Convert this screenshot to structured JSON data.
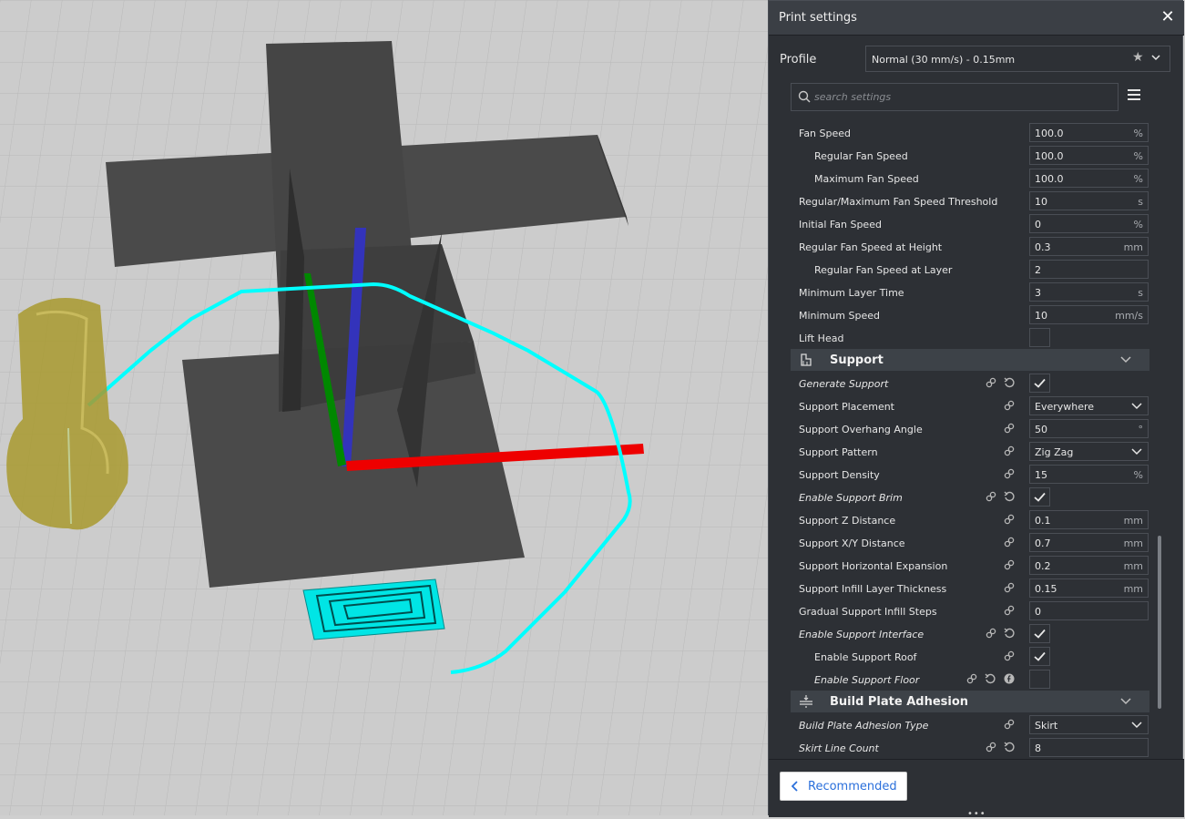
{
  "panel": {
    "title": "Print settings",
    "close": "✕",
    "profile_label": "Profile",
    "profile_value": "Normal (30 mm/s) - 0.15mm",
    "search_placeholder": "search settings"
  },
  "settings": {
    "fan_speed": {
      "label": "Fan Speed",
      "value": "100.0",
      "unit": "%"
    },
    "regular_fan_speed": {
      "label": "Regular Fan Speed",
      "value": "100.0",
      "unit": "%"
    },
    "maximum_fan_speed": {
      "label": "Maximum Fan Speed",
      "value": "100.0",
      "unit": "%"
    },
    "fan_speed_threshold": {
      "label": "Regular/Maximum Fan Speed Threshold",
      "value": "10",
      "unit": "s"
    },
    "initial_fan_speed": {
      "label": "Initial Fan Speed",
      "value": "0",
      "unit": "%"
    },
    "fan_speed_height": {
      "label": "Regular Fan Speed at Height",
      "value": "0.3",
      "unit": "mm"
    },
    "fan_speed_layer": {
      "label": "Regular Fan Speed at Layer",
      "value": "2"
    },
    "min_layer_time": {
      "label": "Minimum Layer Time",
      "value": "3",
      "unit": "s"
    },
    "min_speed": {
      "label": "Minimum Speed",
      "value": "10",
      "unit": "mm/s"
    },
    "lift_head": {
      "label": "Lift Head",
      "checked": false
    }
  },
  "support": {
    "title": "Support",
    "generate_support": {
      "label": "Generate Support",
      "checked": true
    },
    "placement": {
      "label": "Support Placement",
      "value": "Everywhere"
    },
    "overhang_angle": {
      "label": "Support Overhang Angle",
      "value": "50",
      "unit": "°"
    },
    "pattern": {
      "label": "Support Pattern",
      "value": "Zig Zag"
    },
    "density": {
      "label": "Support Density",
      "value": "15",
      "unit": "%"
    },
    "enable_brim": {
      "label": "Enable Support Brim",
      "checked": true
    },
    "z_distance": {
      "label": "Support Z Distance",
      "value": "0.1",
      "unit": "mm"
    },
    "xy_distance": {
      "label": "Support X/Y Distance",
      "value": "0.7",
      "unit": "mm"
    },
    "horizontal_expansion": {
      "label": "Support Horizontal Expansion",
      "value": "0.2",
      "unit": "mm"
    },
    "infill_layer_thickness": {
      "label": "Support Infill Layer Thickness",
      "value": "0.15",
      "unit": "mm"
    },
    "gradual_infill_steps": {
      "label": "Gradual Support Infill Steps",
      "value": "0"
    },
    "enable_interface": {
      "label": "Enable Support Interface",
      "checked": true
    },
    "enable_roof": {
      "label": "Enable Support Roof",
      "checked": true
    },
    "enable_floor": {
      "label": "Enable Support Floor",
      "checked": false
    }
  },
  "adhesion": {
    "title": "Build Plate Adhesion",
    "type": {
      "label": "Build Plate Adhesion Type",
      "value": "Skirt"
    },
    "skirt_line_count": {
      "label": "Skirt Line Count",
      "value": "8"
    }
  },
  "footer": {
    "recommended_label": "Recommended",
    "grip": "•••"
  },
  "colors": {
    "accent_blue": "#2a6fdb",
    "x_axis": "#ff0000",
    "y_axis": "#00aa00",
    "z_axis": "#3333cc",
    "travel": "#00ffff",
    "nozzle": "#b5a332"
  }
}
